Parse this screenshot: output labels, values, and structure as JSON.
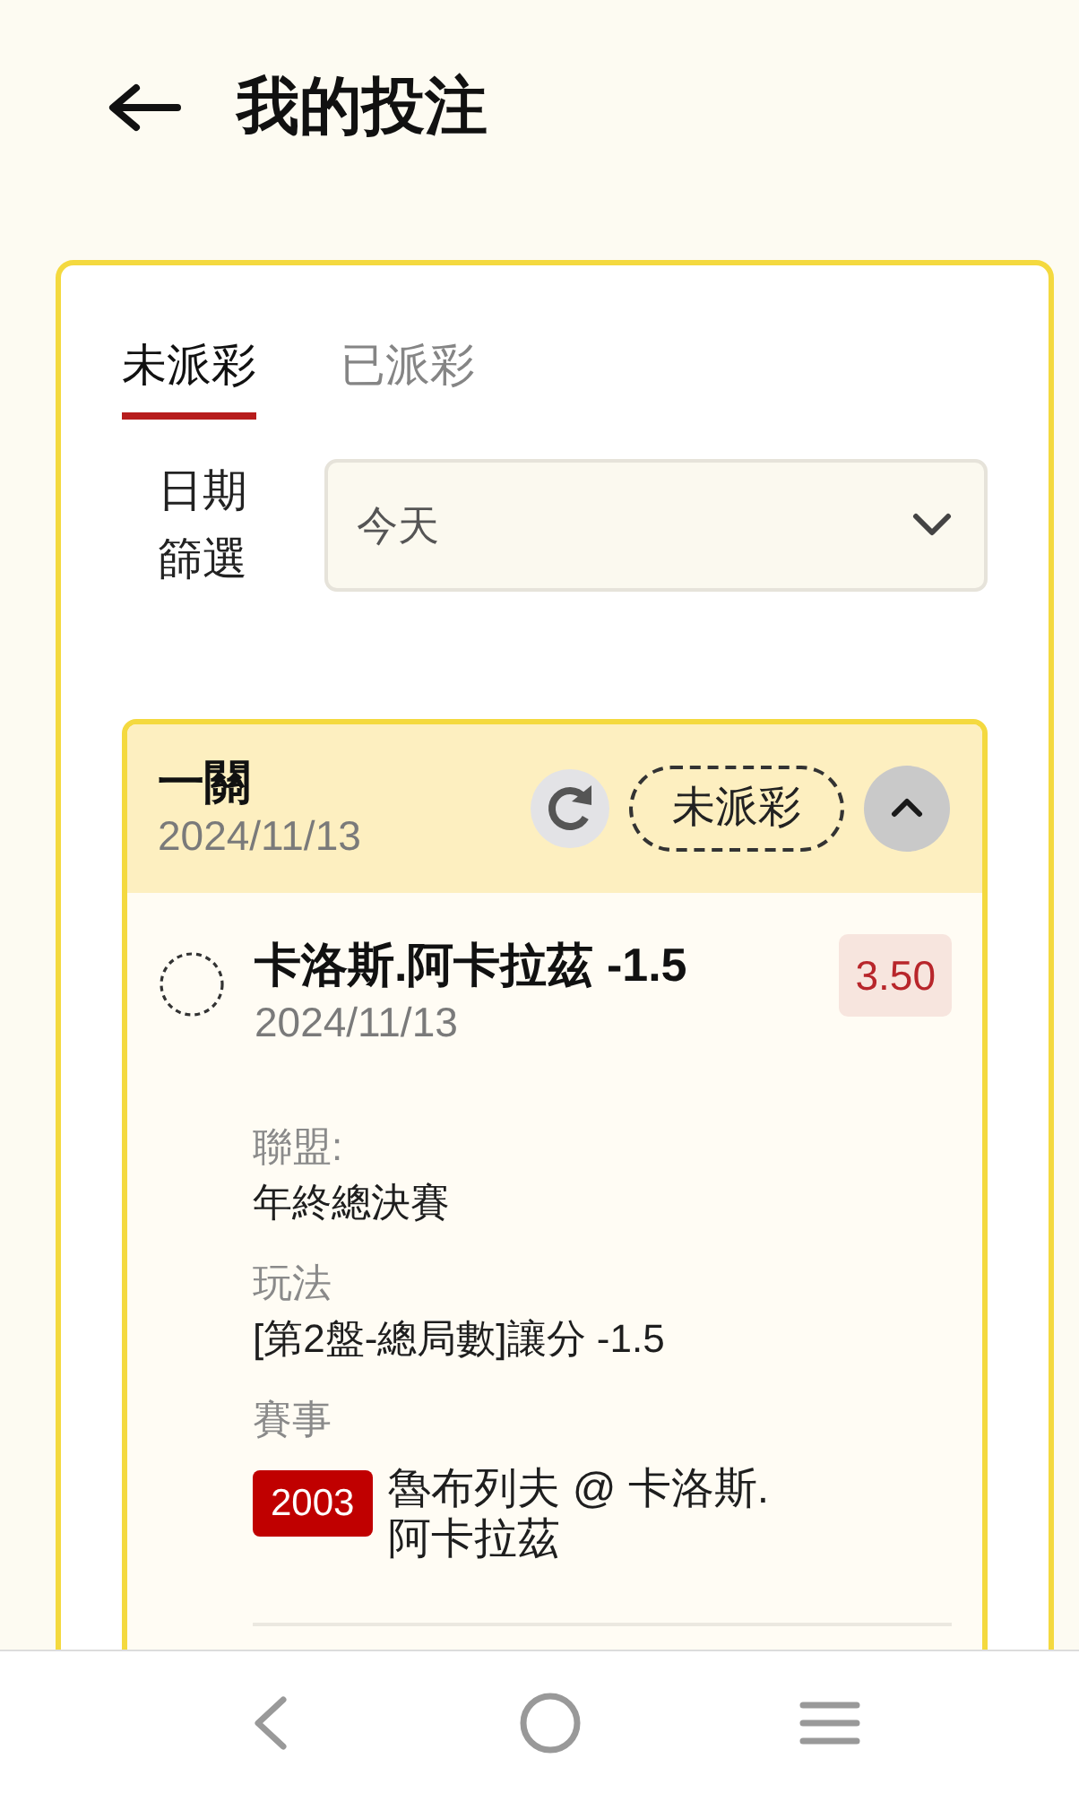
{
  "header": {
    "title": "我的投注"
  },
  "tabs": [
    {
      "label": "未派彩",
      "selected": true
    },
    {
      "label": "已派彩",
      "selected": false
    }
  ],
  "date_filter": {
    "label": "日期篩選",
    "value": "今天"
  },
  "bets": [
    {
      "type": "一關",
      "date": "2024/11/13",
      "status": "未派彩",
      "expanded": true,
      "selections": [
        {
          "name": "卡洛斯.阿卡拉茲 -1.5",
          "date": "2024/11/13",
          "odds": "3.50",
          "details": [
            {
              "kind": "text",
              "label": "聯盟:",
              "value": "年終總決賽"
            },
            {
              "kind": "text",
              "label": "玩法",
              "value": "[第2盤-總局數]讓分 -1.5"
            },
            {
              "kind": "match",
              "label": "賽事",
              "event_no": "2003",
              "value": "魯布列夫 @ 卡洛斯.阿卡拉茲"
            }
          ]
        }
      ]
    }
  ]
}
